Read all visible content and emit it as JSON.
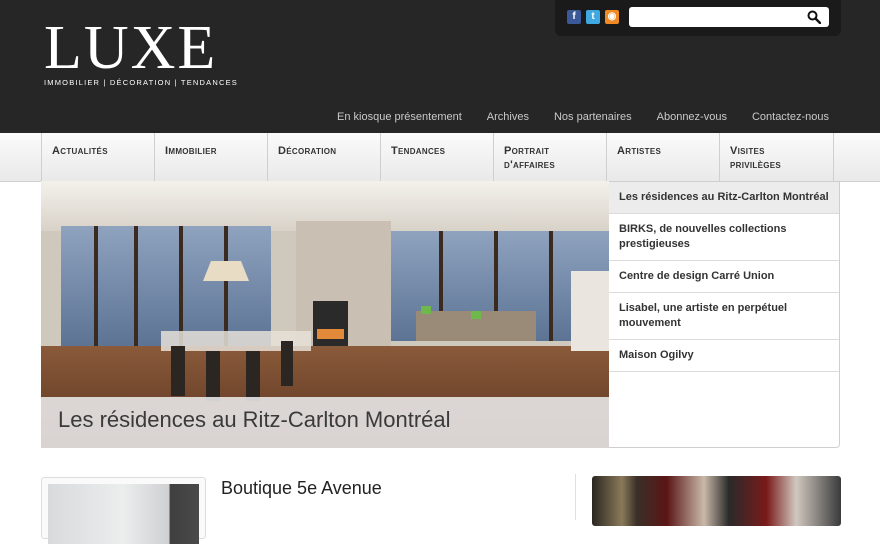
{
  "header": {
    "logo": {
      "word": "LUXE",
      "tagline": "IMMOBILIER | DÉCORATION | TENDANCES"
    },
    "social": [
      {
        "name": "facebook",
        "glyph": "f",
        "color": "#3b5998"
      },
      {
        "name": "twitter",
        "glyph": "t",
        "color": "#3fa8e0"
      },
      {
        "name": "rss",
        "glyph": "◉",
        "color": "#f08a24"
      }
    ],
    "search": {
      "value": "",
      "placeholder": "",
      "icon": "search-icon"
    },
    "utility_links": [
      "En kiosque présentement",
      "Archives",
      "Nos partenaires",
      "Abonnez-vous",
      "Contactez-nous"
    ]
  },
  "nav": {
    "items": [
      {
        "line1": "Actualités",
        "line2": ""
      },
      {
        "line1": "Immobilier",
        "line2": ""
      },
      {
        "line1": "Décoration",
        "line2": ""
      },
      {
        "line1": "Tendances",
        "line2": ""
      },
      {
        "line1": "Portrait",
        "line2": "d'affaires"
      },
      {
        "line1": "Artistes",
        "line2": ""
      },
      {
        "line1": "Visites",
        "line2": "privilèges"
      }
    ]
  },
  "featured": {
    "title": "Les résidences au Ritz-Carlton Montréal",
    "list": [
      "Les résidences au Ritz-Carlton Montréal",
      "BIRKS, de nouvelles collections prestigieuses",
      "Centre de design Carré Union",
      "Lisabel, une artiste en perpétuel mouvement",
      "Maison Ogilvy"
    ],
    "active_index": 0
  },
  "article": {
    "title": "Boutique 5e Avenue"
  },
  "colors": {
    "header_bg": "#262626",
    "nav_text": "#333333",
    "utility_text": "#c9c9c9"
  }
}
